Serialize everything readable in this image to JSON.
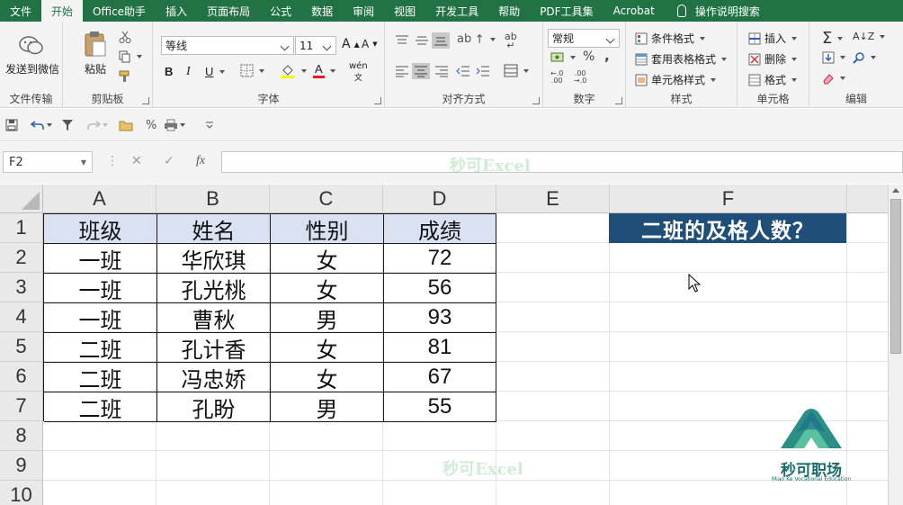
{
  "menu": {
    "tabs": [
      "文件",
      "开始",
      "Office助手",
      "插入",
      "页面布局",
      "公式",
      "数据",
      "审阅",
      "视图",
      "开发工具",
      "帮助",
      "PDF工具集",
      "Acrobat"
    ],
    "active_tab": "开始",
    "search_label": "操作说明搜索"
  },
  "ribbon": {
    "wechat": {
      "button": "发送到微信",
      "group": "文件传输"
    },
    "clipboard": {
      "paste": "粘贴",
      "group": "剪贴板"
    },
    "font": {
      "name": "等线",
      "size": "11",
      "bold": "B",
      "italic": "I",
      "underline": "U",
      "grow": "A",
      "shrink": "A",
      "font_color_letter": "A",
      "phonetic": "wén",
      "group": "字体"
    },
    "alignment": {
      "group": "对齐方式"
    },
    "number": {
      "format": "常规",
      "percent": "%",
      "comma": ",",
      "group": "数字"
    },
    "styles": {
      "conditional": "条件格式",
      "table": "套用表格格式",
      "cell": "单元格样式",
      "group": "样式"
    },
    "cells": {
      "insert": "插入",
      "delete": "删除",
      "format": "格式",
      "group": "单元格"
    },
    "editing": {
      "sum": "Σ",
      "group": "编辑"
    }
  },
  "formula_bar": {
    "name_box": "F2",
    "fx_label": "fx",
    "formula": ""
  },
  "watermark": "秒可Excel",
  "sheet": {
    "columns": [
      "A",
      "B",
      "C",
      "D",
      "E",
      "F"
    ],
    "rows": [
      "1",
      "2",
      "3",
      "4",
      "5",
      "6",
      "7",
      "8",
      "9",
      "10"
    ],
    "header": [
      "班级",
      "姓名",
      "性别",
      "成绩"
    ],
    "data": [
      [
        "一班",
        "华欣琪",
        "女",
        "72"
      ],
      [
        "一班",
        "孔光桃",
        "女",
        "56"
      ],
      [
        "一班",
        "曹秋",
        "男",
        "93"
      ],
      [
        "二班",
        "孔计香",
        "女",
        "81"
      ],
      [
        "二班",
        "冯忠娇",
        "女",
        "67"
      ],
      [
        "二班",
        "孔盼",
        "男",
        "55"
      ]
    ],
    "question": "二班的及格人数？"
  },
  "logo": {
    "name": "秒可职场",
    "subtitle": "Miao Ke Vocational Education"
  },
  "colors": {
    "excel_green": "#217346",
    "header_fill": "#d9e1f2",
    "question_fill": "#1f4e79"
  }
}
